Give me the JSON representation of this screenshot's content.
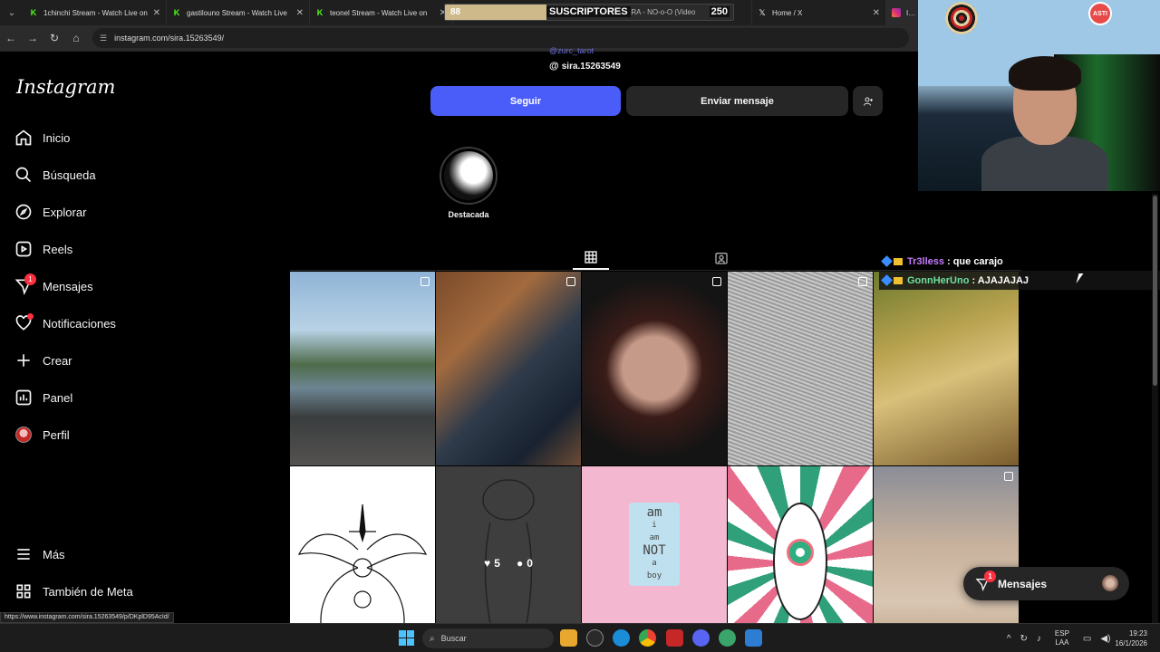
{
  "browser": {
    "tabs": [
      {
        "title": "1chinchi Stream - Watch Live on",
        "favicon": "kick-icon"
      },
      {
        "title": "gastilouno Stream - Watch Live",
        "favicon": "kick-icon"
      },
      {
        "title": "teonel Stream - Watch Live on",
        "favicon": "kick-icon"
      },
      {
        "title": "ARA - NO-o-O (Video",
        "favicon": "youtube-icon"
      },
      {
        "title": "Home / X",
        "favicon": "x-icon"
      },
      {
        "title": "Insta",
        "favicon": "instagram-icon"
      }
    ],
    "url": "instagram.com/sira.15263549/",
    "status_url": "https://www.instagram.com/sira.15263549/p/DKplD95AcId/"
  },
  "sub_goal": {
    "current": "88",
    "label": "SUSCRIPTORES",
    "goal": "250",
    "progress": 0.352
  },
  "sidebar": {
    "logo": "Instagram",
    "items": [
      {
        "label": "Inicio",
        "icon": "home-icon"
      },
      {
        "label": "Búsqueda",
        "icon": "search-icon"
      },
      {
        "label": "Explorar",
        "icon": "compass-icon"
      },
      {
        "label": "Reels",
        "icon": "reels-icon"
      },
      {
        "label": "Mensajes",
        "icon": "messenger-icon",
        "badge": "1"
      },
      {
        "label": "Notificaciones",
        "icon": "heart-icon"
      },
      {
        "label": "Crear",
        "icon": "plus-icon"
      },
      {
        "label": "Panel",
        "icon": "dashboard-icon"
      },
      {
        "label": "Perfil",
        "icon": "avatar-icon"
      }
    ],
    "more": "Más",
    "meta": "También de Meta"
  },
  "profile": {
    "linked_handle": "@zurc_tarot",
    "threads_handle": "sira.15263549",
    "follow_label": "Seguir",
    "message_label": "Enviar mensaje",
    "highlight_label": "Destacada"
  },
  "post_hover": {
    "likes": "5",
    "comments": "0"
  },
  "post_text": {
    "line1": "am",
    "line2": "i",
    "line3": "am",
    "line4": "NOT",
    "line5": "a",
    "line6": "boy"
  },
  "chat": [
    {
      "user": "Tr3lless",
      "message": ": que carajo"
    },
    {
      "user": "GonnHerUno",
      "message": ": AJAJAJAJ"
    }
  ],
  "messages_pill": {
    "label": "Mensajes",
    "badge": "1"
  },
  "webcam": {
    "mascot_text": "ASTI"
  },
  "taskbar": {
    "search_placeholder": "Buscar",
    "lang_line1": "ESP",
    "lang_line2": "LAA",
    "time": "19:23",
    "date": "16/1/2026"
  },
  "colors": {
    "follow_button": "#4a5df9",
    "badge": "#ff3040",
    "background": "#000000"
  }
}
